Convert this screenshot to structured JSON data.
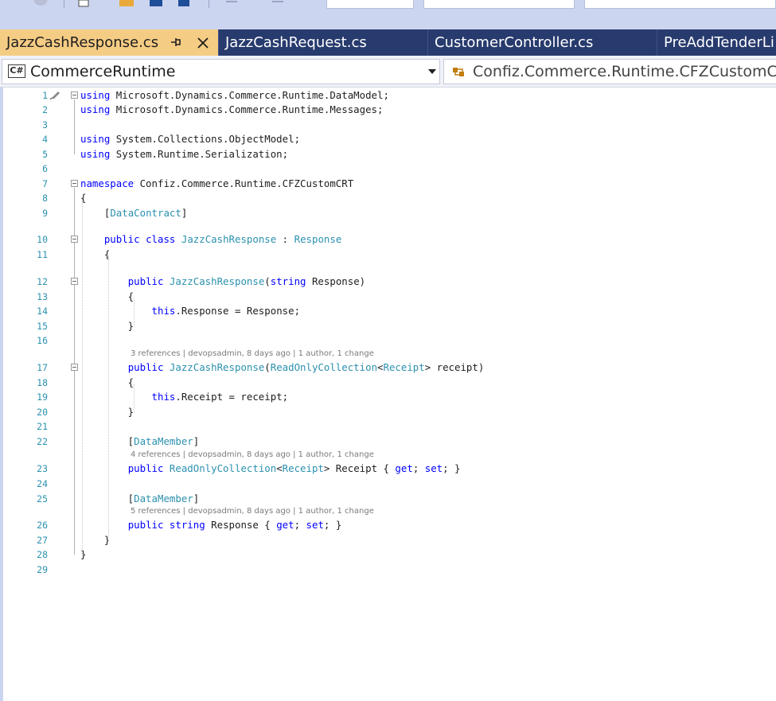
{
  "tabs": [
    {
      "label": "JazzCashResponse.cs",
      "active": true
    },
    {
      "label": "JazzCashRequest.cs",
      "active": false
    },
    {
      "label": "CustomerController.cs",
      "active": false
    },
    {
      "label": "PreAddTenderLi",
      "active": false
    }
  ],
  "tab_buttons": {
    "pin_icon": "pin-icon",
    "close_icon": "close-icon"
  },
  "navbar": {
    "project_badge": "C#",
    "project": "CommerceRuntime",
    "type_scope": "Confiz.Commerce.Runtime.CFZCustomCRT"
  },
  "editor": {
    "lines": [
      {
        "n": "1",
        "tokens": [
          {
            "t": "using",
            "c": "kw"
          },
          {
            "t": " Microsoft.Dynamics.Commerce.Runtime.DataModel;"
          }
        ]
      },
      {
        "n": "2",
        "tokens": [
          {
            "t": "using",
            "c": "kw"
          },
          {
            "t": " Microsoft.Dynamics.Commerce.Runtime.Messages;"
          }
        ]
      },
      {
        "n": "3",
        "tokens": []
      },
      {
        "n": "4",
        "tokens": [
          {
            "t": "using",
            "c": "kw"
          },
          {
            "t": " System.Collections.ObjectModel;"
          }
        ]
      },
      {
        "n": "5",
        "tokens": [
          {
            "t": "using",
            "c": "kw"
          },
          {
            "t": " System.Runtime.Serialization;"
          }
        ]
      },
      {
        "n": "6",
        "tokens": []
      },
      {
        "n": "7",
        "tokens": [
          {
            "t": "namespace",
            "c": "kw"
          },
          {
            "t": " Confiz.Commerce.Runtime.CFZCustomCRT"
          }
        ]
      },
      {
        "n": "8",
        "tokens": [
          {
            "t": "{"
          }
        ]
      },
      {
        "n": "9",
        "tokens": [
          {
            "t": "    ["
          },
          {
            "t": "DataContract",
            "c": "ty"
          },
          {
            "t": "]"
          }
        ]
      },
      {
        "n": "10",
        "tokens": [
          {
            "t": "    "
          },
          {
            "t": "public",
            "c": "kw"
          },
          {
            "t": " "
          },
          {
            "t": "class",
            "c": "kw"
          },
          {
            "t": " "
          },
          {
            "t": "JazzCashResponse",
            "c": "ty"
          },
          {
            "t": " : "
          },
          {
            "t": "Response",
            "c": "ty"
          }
        ]
      },
      {
        "n": "11",
        "tokens": [
          {
            "t": "    {"
          }
        ]
      },
      {
        "n": "12",
        "tokens": [
          {
            "t": "        "
          },
          {
            "t": "public",
            "c": "kw"
          },
          {
            "t": " "
          },
          {
            "t": "JazzCashResponse",
            "c": "ty"
          },
          {
            "t": "("
          },
          {
            "t": "string",
            "c": "kw"
          },
          {
            "t": " Response)"
          }
        ]
      },
      {
        "n": "13",
        "tokens": [
          {
            "t": "        {"
          }
        ]
      },
      {
        "n": "14",
        "tokens": [
          {
            "t": "            "
          },
          {
            "t": "this",
            "c": "kw"
          },
          {
            "t": ".Response = Response;"
          }
        ]
      },
      {
        "n": "15",
        "tokens": [
          {
            "t": "        }"
          }
        ]
      },
      {
        "n": "16",
        "tokens": []
      },
      {
        "n": "17",
        "tokens": [
          {
            "t": "        "
          },
          {
            "t": "public",
            "c": "kw"
          },
          {
            "t": " "
          },
          {
            "t": "JazzCashResponse",
            "c": "ty"
          },
          {
            "t": "("
          },
          {
            "t": "ReadOnlyCollection",
            "c": "ty"
          },
          {
            "t": "<"
          },
          {
            "t": "Receipt",
            "c": "ty"
          },
          {
            "t": "> receipt)"
          }
        ]
      },
      {
        "n": "18",
        "tokens": [
          {
            "t": "        {"
          }
        ]
      },
      {
        "n": "19",
        "tokens": [
          {
            "t": "            "
          },
          {
            "t": "this",
            "c": "kw"
          },
          {
            "t": ".Receipt = receipt;"
          }
        ]
      },
      {
        "n": "20",
        "tokens": [
          {
            "t": "        }"
          }
        ]
      },
      {
        "n": "21",
        "tokens": []
      },
      {
        "n": "22",
        "tokens": [
          {
            "t": "        ["
          },
          {
            "t": "DataMember",
            "c": "ty"
          },
          {
            "t": "]"
          }
        ]
      },
      {
        "n": "23",
        "tokens": [
          {
            "t": "        "
          },
          {
            "t": "public",
            "c": "kw"
          },
          {
            "t": " "
          },
          {
            "t": "ReadOnlyCollection",
            "c": "ty"
          },
          {
            "t": "<"
          },
          {
            "t": "Receipt",
            "c": "ty"
          },
          {
            "t": "> Receipt { "
          },
          {
            "t": "get",
            "c": "kw"
          },
          {
            "t": "; "
          },
          {
            "t": "set",
            "c": "kw"
          },
          {
            "t": "; }"
          }
        ]
      },
      {
        "n": "24",
        "tokens": []
      },
      {
        "n": "25",
        "tokens": [
          {
            "t": "        ["
          },
          {
            "t": "DataMember",
            "c": "ty"
          },
          {
            "t": "]"
          }
        ]
      },
      {
        "n": "26",
        "tokens": [
          {
            "t": "        "
          },
          {
            "t": "public",
            "c": "kw"
          },
          {
            "t": " "
          },
          {
            "t": "string",
            "c": "kw"
          },
          {
            "t": " Response { "
          },
          {
            "t": "get",
            "c": "kw"
          },
          {
            "t": "; "
          },
          {
            "t": "set",
            "c": "kw"
          },
          {
            "t": "; }"
          }
        ]
      },
      {
        "n": "27",
        "tokens": [
          {
            "t": "    }"
          }
        ]
      },
      {
        "n": "28",
        "tokens": [
          {
            "t": "}"
          }
        ]
      },
      {
        "n": "29",
        "tokens": []
      }
    ],
    "codelens": [
      {
        "before_line": "17",
        "text": "3 references | devopsadmin, 8 days ago | 1 author, 1 change"
      },
      {
        "before_line": "23",
        "text": "4 references | devopsadmin, 8 days ago | 1 author, 1 change"
      },
      {
        "before_line": "26",
        "text": "5 references | devopsadmin, 8 days ago | 1 author, 1 change"
      }
    ],
    "fold_lines": [
      "1",
      "7",
      "10",
      "12",
      "17"
    ]
  },
  "colors": {
    "keyword": "#0000ff",
    "type": "#2b91af",
    "line_number": "#2b91af",
    "active_tab": "#f5cc84",
    "tab_well": "#283b6e",
    "toolbar": "#ccd5f0"
  }
}
